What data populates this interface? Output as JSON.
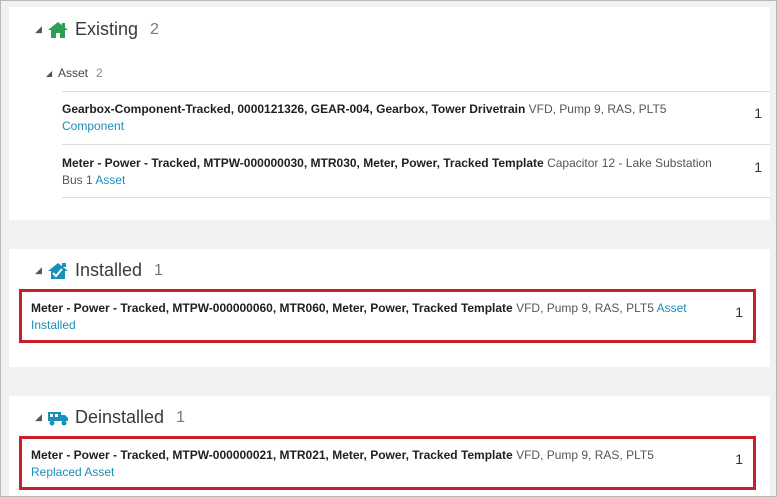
{
  "sections": {
    "existing": {
      "title": "Existing",
      "count": "2",
      "icon": "house-icon",
      "group": {
        "label": "Asset",
        "count": "2",
        "rows": [
          {
            "bold": "Gearbox-Component-Tracked, 0000121326, GEAR-004, Gearbox, Tower Drivetrain",
            "location": " VFD, Pump 9, RAS, PLT5 ",
            "link": "Component",
            "qty": "1"
          },
          {
            "bold": "Meter - Power - Tracked, MTPW-000000030, MTR030, Meter, Power, Tracked Template",
            "location": " Capacitor 12 - Lake Substation Bus 1 ",
            "link": "Asset",
            "qty": "1"
          }
        ]
      }
    },
    "installed": {
      "title": "Installed",
      "count": "1",
      "icon": "house-check-icon",
      "row": {
        "bold": "Meter - Power - Tracked, MTPW-000000060, MTR060, Meter, Power, Tracked Template",
        "location": " VFD, Pump 9, RAS, PLT5 ",
        "link": "Asset Installed",
        "qty": "1"
      }
    },
    "deinstalled": {
      "title": "Deinstalled",
      "count": "1",
      "icon": "truck-icon",
      "row": {
        "bold": "Meter - Power - Tracked, MTPW-000000021, MTR021, Meter, Power, Tracked Template",
        "location": " VFD, Pump 9, RAS, PLT5 ",
        "link": "Replaced Asset",
        "qty": "1"
      }
    }
  },
  "colors": {
    "accent_green": "#2e9e57",
    "accent_blue": "#1a8fb8",
    "highlight_red": "#c8202a"
  }
}
